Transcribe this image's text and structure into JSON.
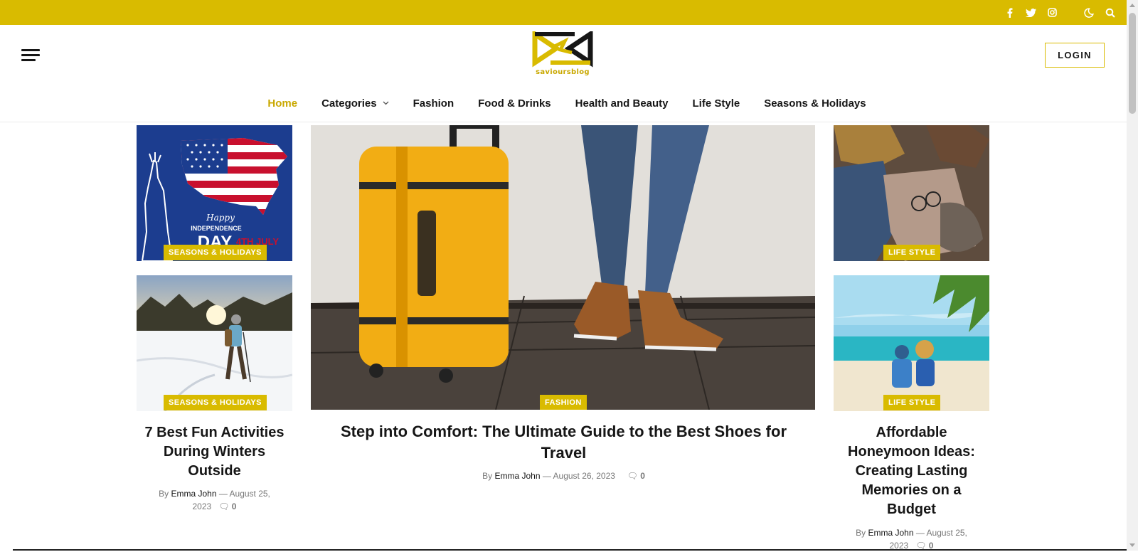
{
  "topbar": {
    "icons": [
      "facebook-icon",
      "twitter-icon",
      "instagram-icon",
      "moon-icon",
      "search-icon"
    ]
  },
  "header": {
    "logo_text": "savioursblog",
    "login_label": "LOGIN"
  },
  "nav": {
    "items": [
      {
        "label": "Home",
        "active": true
      },
      {
        "label": "Categories",
        "dropdown": true
      },
      {
        "label": "Fashion"
      },
      {
        "label": "Food & Drinks"
      },
      {
        "label": "Health and Beauty"
      },
      {
        "label": "Life Style"
      },
      {
        "label": "Seasons & Holidays"
      }
    ]
  },
  "posts": {
    "left_top": {
      "category": "SEASONS & HOLIDAYS",
      "image_text_1": "Happy",
      "image_text_2": "INDEPENDENCE",
      "image_text_3": "DAY",
      "image_text_4": "4TH JULY"
    },
    "left_bottom": {
      "category": "SEASONS & HOLIDAYS",
      "title": "7 Best Fun Activities During Winters Outside",
      "by": "By",
      "author": "Emma John",
      "date": "August 25, 2023",
      "comments": "0"
    },
    "featured": {
      "category": "FASHION",
      "title": "Step into Comfort: The Ultimate Guide to the Best Shoes for Travel",
      "by": "By",
      "author": "Emma John",
      "date": "August 26, 2023",
      "comments": "0"
    },
    "right_top": {
      "category": "LIFE STYLE"
    },
    "right_bottom": {
      "category": "LIFE STYLE",
      "title": "Affordable Honeymoon Ideas: Creating Lasting Memories on a Budget",
      "by": "By",
      "author": "Emma John",
      "date": "August 25, 2023",
      "comments": "0"
    }
  },
  "colors": {
    "accent": "#d9bb00",
    "text": "#161616",
    "meta": "#777777"
  }
}
